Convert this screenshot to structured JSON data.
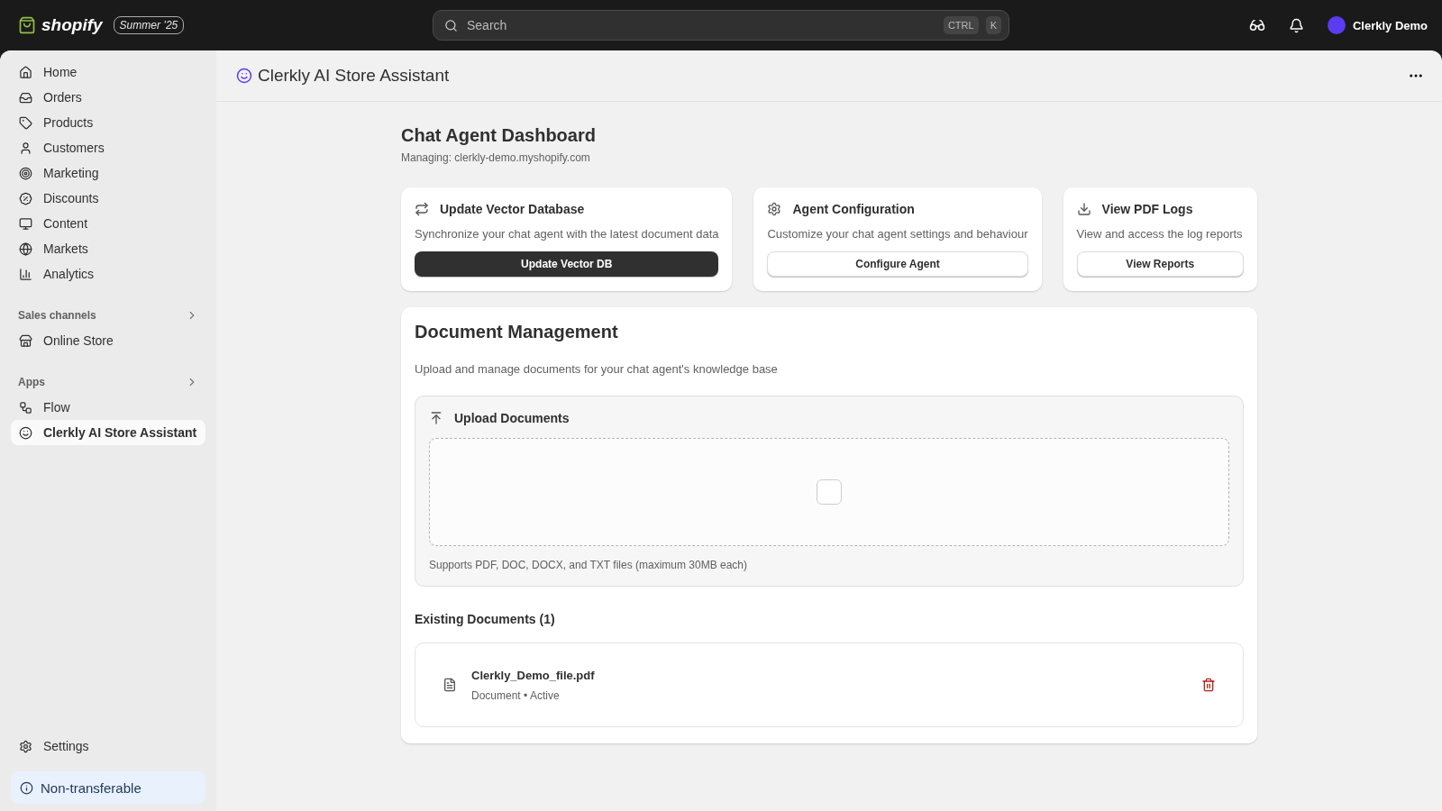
{
  "topbar": {
    "logo": "shopify",
    "edition": "Summer ’25",
    "search": {
      "placeholder": "Search",
      "keys": [
        "CTRL",
        "K"
      ]
    },
    "user": "Clerkly Demo"
  },
  "sidebar": {
    "items": [
      {
        "label": "Home",
        "selected": false
      },
      {
        "label": "Orders",
        "selected": false
      },
      {
        "label": "Products",
        "selected": false
      },
      {
        "label": "Customers",
        "selected": false
      },
      {
        "label": "Marketing",
        "selected": false
      },
      {
        "label": "Discounts",
        "selected": false
      },
      {
        "label": "Content",
        "selected": false
      },
      {
        "label": "Markets",
        "selected": false
      },
      {
        "label": "Analytics",
        "selected": false
      }
    ],
    "sections": [
      {
        "title": "Sales channels",
        "items": [
          {
            "label": "Online Store",
            "selected": false
          }
        ]
      },
      {
        "title": "Apps",
        "items": [
          {
            "label": "Flow",
            "selected": false
          },
          {
            "label": "Clerkly AI Store Assistant",
            "selected": true
          }
        ]
      }
    ],
    "settings": "Settings",
    "notice": "Non-transferable"
  },
  "page": {
    "title": "Clerkly AI Store Assistant",
    "heading": "Chat Agent Dashboard",
    "subheading": "Managing: clerkly-demo.myshopify.com",
    "cards": [
      {
        "title": "Update Vector Database",
        "text": "Synchronize your chat agent with the latest document data",
        "button": "Update Vector DB",
        "primary": true
      },
      {
        "title": "Agent Configuration",
        "text": "Customize your chat agent settings and behaviour",
        "button": "Configure Agent",
        "primary": false
      },
      {
        "title": "View PDF Logs",
        "text": "View and access the log reports",
        "button": "View Reports",
        "primary": false
      }
    ],
    "documents": {
      "title": "Document Management",
      "text": "Upload and manage documents for your chat agent's knowledge base",
      "upload": {
        "title": "Upload Documents",
        "hint": "Supports PDF, DOC, DOCX, and TXT files (maximum 30MB each)"
      },
      "existing_title": "Existing Documents (1)",
      "files": [
        {
          "name": "Clerkly_Demo_file.pdf",
          "meta": "Document • Active"
        }
      ]
    }
  }
}
